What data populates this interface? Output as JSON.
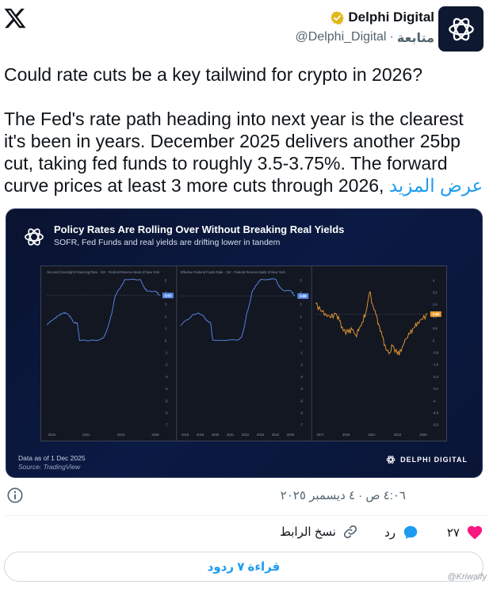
{
  "header": {
    "display_name": "Delphi Digital",
    "handle": "@Delphi_Digital",
    "separator": "·",
    "follow_label": "متابعة"
  },
  "tweet": {
    "paragraph_1": "Could rate cuts be a key tailwind for crypto in 2026?",
    "paragraph_2": "The Fed's rate path heading into next year is the clearest it's been in years. December 2025 delivers another 25bp cut, taking fed funds to roughly 3.5-3.75%. The forward curve prices at least 3 more cuts through 2026,",
    "show_more": "عرض المزيد"
  },
  "media": {
    "title": "Policy Rates Are Rolling Over Without Breaking Real Yields",
    "subtitle": "SOFR, Fed Funds and real yields are drifting lower in tandem",
    "note": "Data as of 1 Dec 2025",
    "source": "Source: TradingView",
    "brand": "DELPHI DIGITAL"
  },
  "chart_data": [
    {
      "type": "line",
      "title": "Secured Overnight Financing Rate · 1W · Federal Reserve Bank of New York",
      "x_ticks": [
        "2018",
        "2021",
        "2023",
        "2026"
      ],
      "y_ticks": [
        "5",
        "4",
        "3",
        "2",
        "1",
        "0",
        "-1",
        "-2",
        "-3",
        "-4",
        "-5",
        "-6",
        "-7"
      ],
      "last_value_label": "3.93",
      "color": "#5b8def",
      "ylim": [
        -7.5,
        5.5
      ],
      "x": [
        2018.0,
        2018.5,
        2018.8,
        2019.1,
        2019.3,
        2019.5,
        2019.7,
        2019.9,
        2020.15,
        2020.3,
        2021.5,
        2022.0,
        2022.2,
        2022.4,
        2022.6,
        2022.8,
        2023.0,
        2023.3,
        2023.5,
        2024.6,
        2024.75,
        2024.9,
        2025.1,
        2025.7,
        2025.85,
        2025.95
      ],
      "values": [
        1.4,
        1.9,
        2.2,
        2.4,
        2.45,
        2.3,
        2.0,
        1.6,
        1.55,
        0.05,
        0.05,
        0.3,
        0.8,
        1.6,
        2.5,
        3.8,
        4.3,
        4.8,
        5.3,
        5.3,
        4.9,
        4.55,
        4.3,
        4.3,
        4.1,
        3.93
      ]
    },
    {
      "type": "line",
      "title": "Effective Federal Funds Rate · 1W · Federal Reserve Bank of New York",
      "x_ticks": [
        "2018",
        "2019",
        "2020",
        "2021",
        "2022",
        "2023",
        "2024",
        "2025"
      ],
      "y_ticks": [
        "5",
        "4",
        "3",
        "2",
        "1",
        "0",
        "-1",
        "-2",
        "-3",
        "-4",
        "-5",
        "-6",
        "-7"
      ],
      "last_value_label": "3.88",
      "color": "#5b8def",
      "ylim": [
        -7.5,
        5.5
      ],
      "x": [
        2018.0,
        2018.3,
        2018.6,
        2018.9,
        2019.3,
        2019.6,
        2019.8,
        2020.1,
        2020.25,
        2022.0,
        2022.25,
        2022.45,
        2022.6,
        2022.8,
        2023.0,
        2023.3,
        2023.6,
        2024.65,
        2024.8,
        2024.95,
        2025.2,
        2025.7,
        2025.85,
        2025.95
      ],
      "values": [
        1.35,
        1.7,
        1.95,
        2.3,
        2.4,
        2.15,
        1.8,
        1.55,
        0.08,
        0.08,
        0.35,
        1.2,
        2.3,
        3.1,
        4.3,
        4.85,
        5.33,
        5.33,
        4.85,
        4.6,
        4.33,
        4.33,
        4.1,
        3.88
      ]
    },
    {
      "type": "line",
      "title": "",
      "x_ticks": [
        "2017",
        "2019",
        "2021",
        "2023",
        "2025"
      ],
      "y_ticks": [
        "4",
        "3.2",
        "2.4",
        "1.6",
        "0.8",
        "0",
        "-0.8",
        "-1.6",
        "-2.4",
        "-3.2",
        "-4",
        "-4.8",
        "-5.6"
      ],
      "last_value_label": "1.86",
      "color": "#f0a030",
      "ylim": [
        -6.0,
        4.4
      ],
      "x": [
        2017.0,
        2017.4,
        2017.8,
        2018.2,
        2018.6,
        2018.9,
        2019.2,
        2019.6,
        2019.9,
        2020.2,
        2020.4,
        2020.7,
        2021.0,
        2021.3,
        2021.5,
        2021.8,
        2022.0,
        2022.3,
        2022.6,
        2022.9,
        2023.1,
        2023.5,
        2023.8,
        2024.1,
        2024.5,
        2024.8,
        2025.1,
        2025.5,
        2025.9
      ],
      "values": [
        2.6,
        2.1,
        1.9,
        1.6,
        1.9,
        1.4,
        0.7,
        0.6,
        0.8,
        0.4,
        0.7,
        1.3,
        2.0,
        3.4,
        2.6,
        1.8,
        1.2,
        0.3,
        -0.6,
        -0.8,
        -0.3,
        -0.9,
        -0.7,
        0.1,
        0.5,
        0.9,
        1.3,
        1.5,
        1.86
      ]
    }
  ],
  "footer": {
    "timestamp": "٤:٠٦ ص · ٤ ديسمبر ٢٠٢٥",
    "like_count": "٢٧",
    "reply_label": "رد",
    "copy_link_label": "نسخ الرابط",
    "read_replies_label": "قراءة ٧ ردود",
    "watermark": "@Kriwaify"
  },
  "colors": {
    "accent": "#1d9bf0",
    "like": "#f91880",
    "media_bg": "#0b1a44"
  },
  "icons": [
    "x-logo-icon",
    "verified-badge-icon",
    "delphi-logo-icon",
    "info-icon",
    "heart-icon",
    "reply-bubble-icon",
    "link-icon"
  ]
}
